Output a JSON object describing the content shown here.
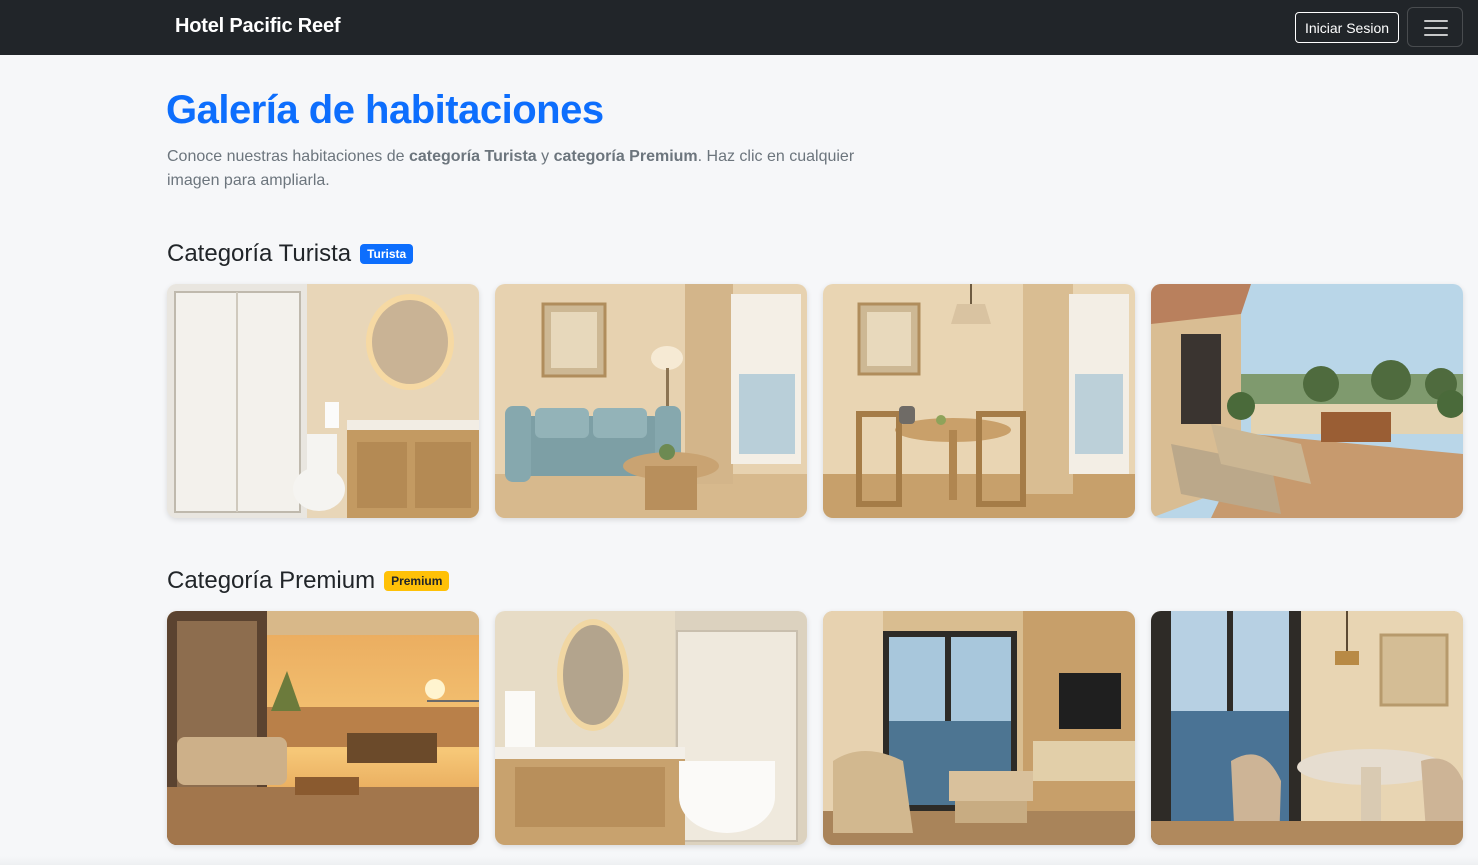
{
  "navbar": {
    "brand": "Hotel Pacific Reef",
    "login_label": "Iniciar Sesion",
    "menu_icon": "hamburger-menu-icon"
  },
  "page": {
    "title": "Galería de habitaciones",
    "intro_1": "Conoce nuestras habitaciones de ",
    "intro_b1": "categoría Turista",
    "intro_2": " y ",
    "intro_b2": "categoría Premium",
    "intro_3": ". Haz clic en cualquier imagen para ampliarla."
  },
  "turista": {
    "heading": "Categoría Turista",
    "badge": "Turista",
    "images": [
      "bathroom-photo",
      "living-room-photo",
      "dining-nook-photo",
      "terrace-photo"
    ]
  },
  "premium": {
    "heading": "Categoría Premium",
    "badge": "Premium",
    "images": [
      "sunset-balcony-photo",
      "luxury-bathroom-photo",
      "ocean-view-lounge-photo",
      "ocean-view-dining-photo"
    ]
  },
  "colors": {
    "navbar_bg": "#212529",
    "title_blue": "#0d6efd",
    "badge_turista": "#0d6efd",
    "badge_premium": "#ffc107",
    "page_bg": "#f6f7f9"
  }
}
